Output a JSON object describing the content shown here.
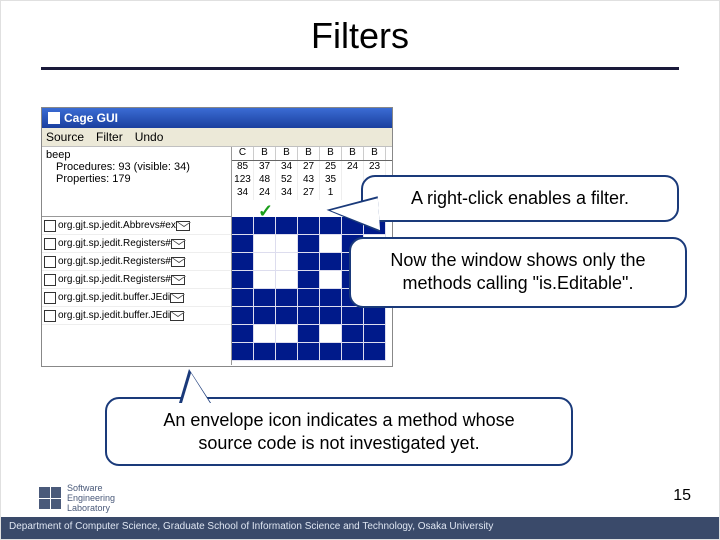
{
  "title": "Filters",
  "window": {
    "title": "Cage GUI",
    "menu": {
      "source": "Source",
      "filter": "Filter",
      "undo": "Undo"
    }
  },
  "tree": {
    "root": "beep",
    "line1": "Procedures: 93 (visible: 34)",
    "line2": "Properties: 179"
  },
  "list": [
    "org.gjt.sp.jedit.Abbrevs#ex",
    "org.gjt.sp.jedit.Registers#",
    "org.gjt.sp.jedit.Registers#",
    "org.gjt.sp.jedit.Registers#",
    "org.gjt.sp.jedit.buffer.JEdi",
    "org.gjt.sp.jedit.buffer.JEdi"
  ],
  "grid": {
    "headers": [
      "C",
      "B",
      "B",
      "B",
      "B",
      "B",
      "B"
    ],
    "rows": [
      [
        "85",
        "37",
        "34",
        "27",
        "25",
        "24",
        "23"
      ],
      [
        "123",
        "48",
        "52",
        "43",
        "35",
        "",
        ""
      ],
      [
        "34",
        "24",
        "34",
        "27",
        "1",
        "",
        ""
      ]
    ]
  },
  "callouts": {
    "c1": "A right-click enables a filter.",
    "c2a": "Now the window shows only the",
    "c2b": "methods calling \"is.Editable\".",
    "c3a": "An envelope icon indicates a method whose",
    "c3b": "source code is not investigated yet."
  },
  "page_number": "15",
  "footer": "Department of Computer Science, Graduate School of Information Science and Technology, Osaka University",
  "logo": {
    "l1": "Software",
    "l2": "Engineering",
    "l3": "Laboratory"
  },
  "matrix": [
    [
      1,
      1,
      1,
      1,
      1,
      1,
      1
    ],
    [
      1,
      0,
      0,
      1,
      0,
      1,
      0
    ],
    [
      1,
      0,
      0,
      1,
      1,
      1,
      0
    ],
    [
      1,
      0,
      0,
      1,
      0,
      1,
      0
    ],
    [
      1,
      1,
      1,
      1,
      1,
      1,
      1
    ],
    [
      1,
      1,
      1,
      1,
      1,
      1,
      1
    ],
    [
      1,
      0,
      0,
      1,
      0,
      1,
      1
    ],
    [
      1,
      1,
      1,
      1,
      1,
      1,
      1
    ]
  ]
}
